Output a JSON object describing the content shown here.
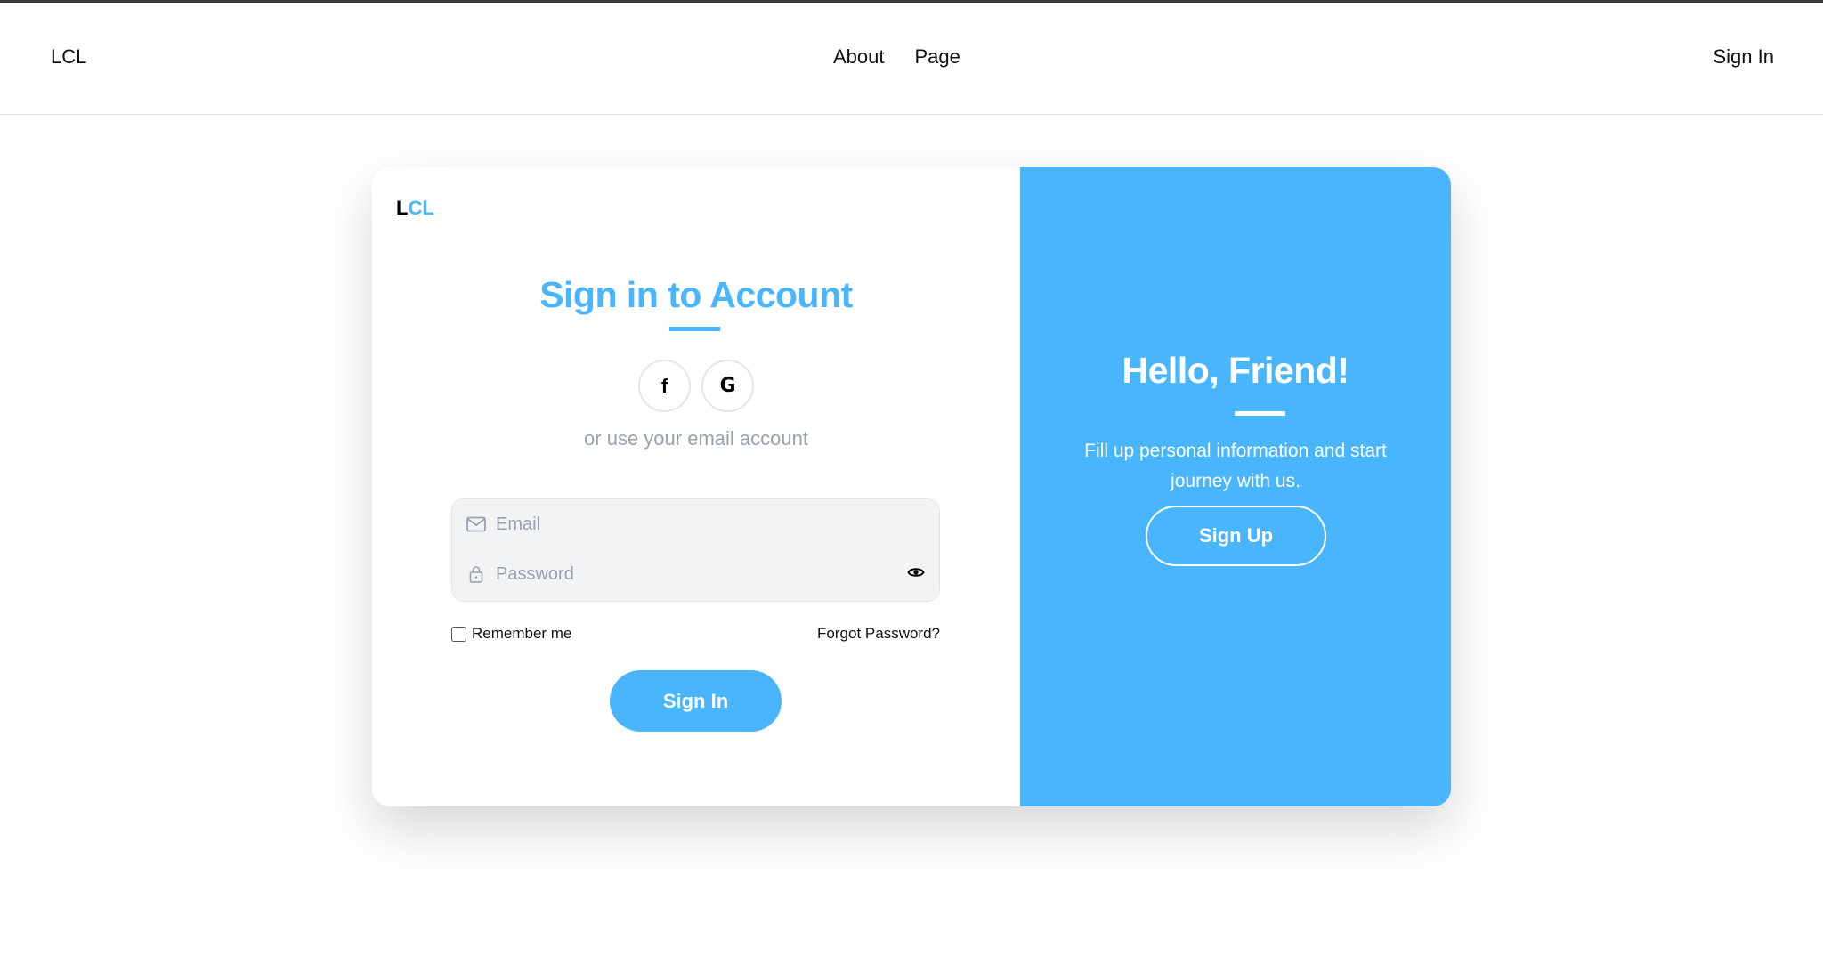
{
  "navbar": {
    "brand": "LCL",
    "links": [
      {
        "label": "About"
      },
      {
        "label": "Page"
      }
    ],
    "signin_label": "Sign In"
  },
  "card": {
    "logo_prefix": "L",
    "logo_suffix": "CL",
    "title": "Sign in to Account",
    "social_buttons": [
      {
        "icon": "facebook-icon",
        "glyph": "f"
      },
      {
        "icon": "google-icon",
        "glyph": "G"
      }
    ],
    "alt_text": "or use your email account",
    "email": {
      "placeholder": "Email",
      "value": "",
      "icon": "mail-icon"
    },
    "password": {
      "placeholder": "Password",
      "value": "",
      "icon": "lock-icon",
      "toggle_icon": "eye-icon"
    },
    "remember_label": "Remember me",
    "remember_checked": false,
    "forgot_label": "Forgot Password?",
    "signin_button": "Sign In"
  },
  "panel": {
    "title": "Hello, Friend!",
    "description": "Fill up personal information and start journey with us.",
    "signup_button": "Sign Up"
  },
  "colors": {
    "accent": "#48b5fc",
    "muted_text": "#9aa1ae",
    "field_bg": "#f2f3f5"
  }
}
